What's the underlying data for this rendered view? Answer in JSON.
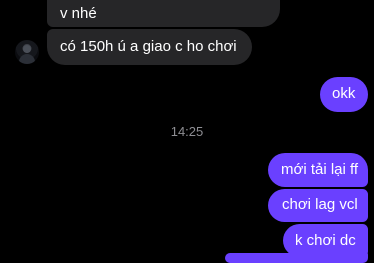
{
  "conversation": {
    "timestamp": "14:25",
    "incoming_messages": [
      {
        "text": "v nhé"
      },
      {
        "text": "có 150h ú a giao c ho chơi"
      }
    ],
    "outgoing_messages": [
      {
        "text": "okk"
      },
      {
        "text": "mới tải lại ff"
      },
      {
        "text": "chơi lag vcl"
      },
      {
        "text": "k chơi dc"
      }
    ]
  },
  "colors": {
    "background": "#000000",
    "incoming_bubble": "#262628",
    "outgoing_bubble": "#6a40ff",
    "timestamp_text": "#8e8e93"
  }
}
